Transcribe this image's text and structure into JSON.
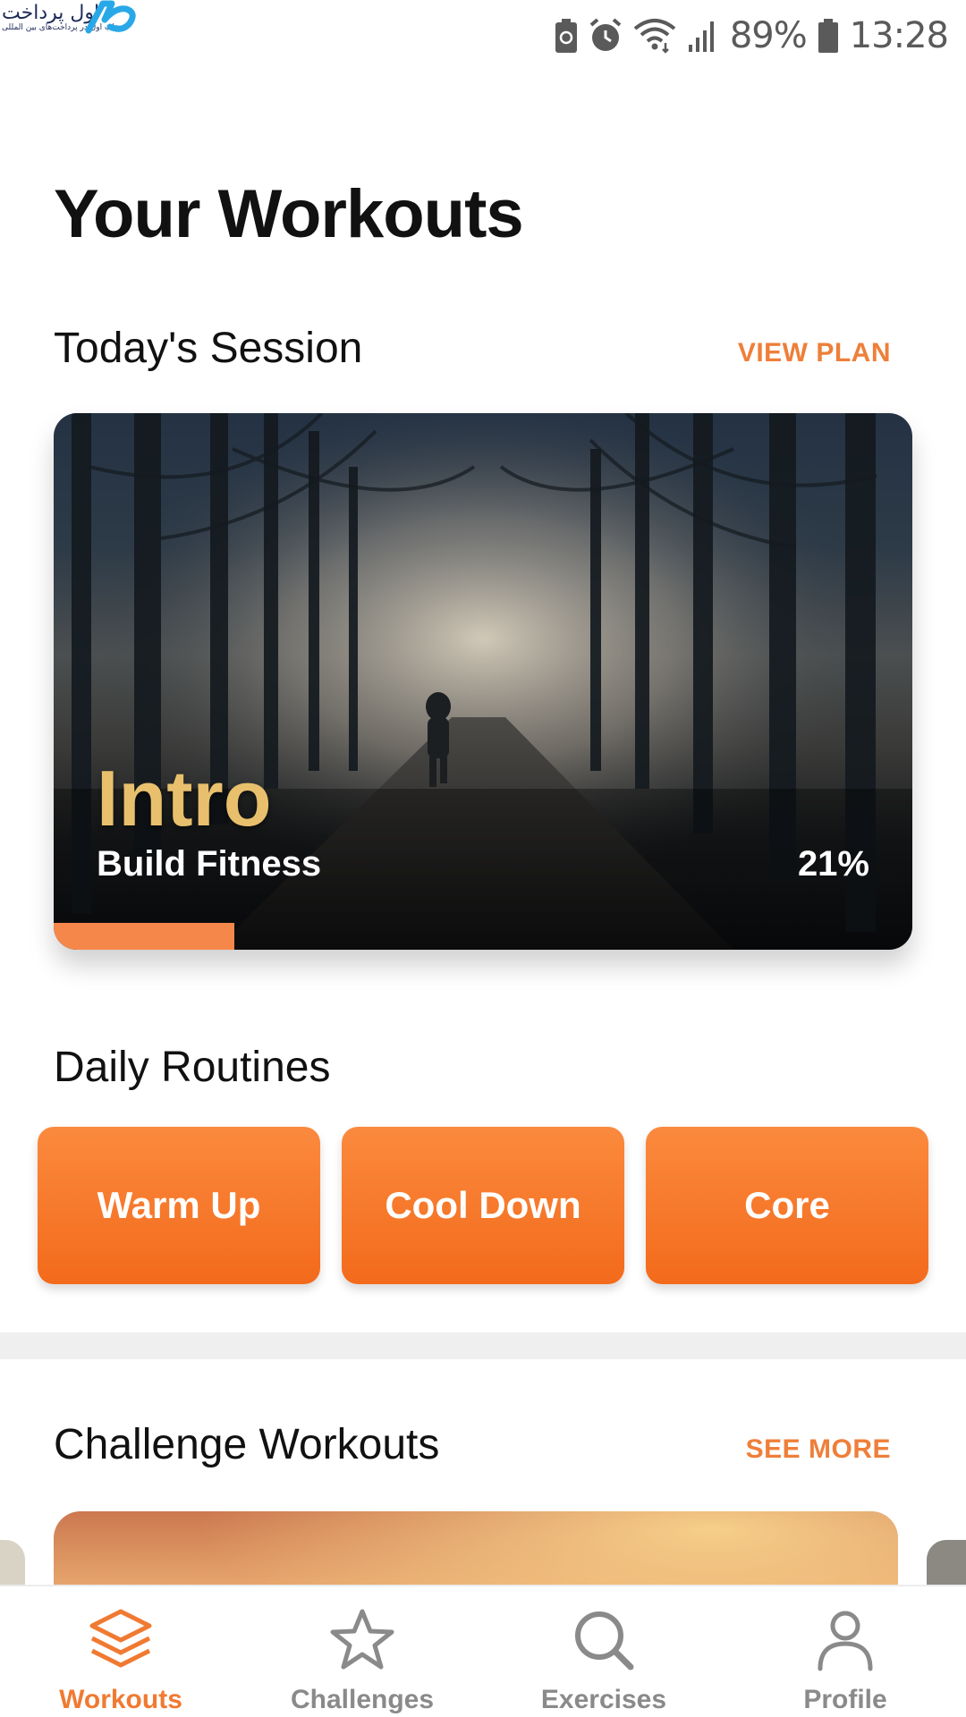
{
  "status_bar": {
    "logo_text": "اول پرداخت",
    "logo_subtext": "انتخاب اول در پرداخت‌های بین المللی",
    "battery_percent": "89%",
    "time": "13:28",
    "icons": [
      "battery-saver-icon",
      "alarm-icon",
      "wifi-icon",
      "signal-icon",
      "battery-icon"
    ]
  },
  "page": {
    "title": "Your Workouts"
  },
  "todays_session": {
    "heading": "Today's Session",
    "link": "VIEW PLAN",
    "card": {
      "title": "Intro",
      "subtitle": "Build Fitness",
      "progress_label": "21%",
      "progress": 0.21,
      "accent_color": "#f5874a",
      "title_color": "#e8c06d"
    }
  },
  "daily_routines": {
    "heading": "Daily Routines",
    "items": [
      "Warm Up",
      "Cool Down",
      "Core"
    ],
    "button_color": "#f36a1b"
  },
  "challenge_workouts": {
    "heading": "Challenge Workouts",
    "link": "SEE MORE"
  },
  "bottom_nav": {
    "items": [
      {
        "label": "Workouts",
        "icon": "layers-icon",
        "active": true
      },
      {
        "label": "Challenges",
        "icon": "star-icon",
        "active": false
      },
      {
        "label": "Exercises",
        "icon": "search-icon",
        "active": false
      },
      {
        "label": "Profile",
        "icon": "user-icon",
        "active": false
      }
    ],
    "active_color": "#f07a32",
    "inactive_color": "#8a8a8a"
  }
}
